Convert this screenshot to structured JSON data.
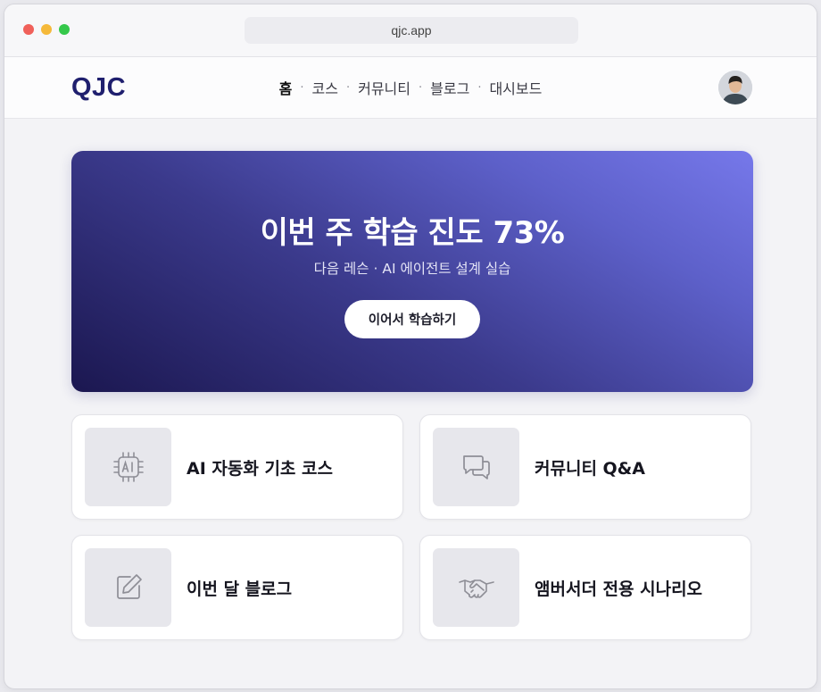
{
  "browser": {
    "url": "qjc.app"
  },
  "nav": {
    "logo": "QJC",
    "items": [
      {
        "label": "홈",
        "active": true
      },
      {
        "label": "코스",
        "active": false
      },
      {
        "label": "커뮤니티",
        "active": false
      },
      {
        "label": "블로그",
        "active": false
      },
      {
        "label": "대시보드",
        "active": false
      }
    ],
    "separator": "·"
  },
  "hero": {
    "title": "이번 주 학습 진도 73%",
    "progress_percent": 73,
    "subtitle": "다음 레슨 · AI 에이전트 설계 실습",
    "button_label": "이어서 학습하기"
  },
  "cards": [
    {
      "label": "AI 자동화 기초 코스",
      "icon": "ai-chip-icon"
    },
    {
      "label": "커뮤니티 Q&A",
      "icon": "chat-bubbles-icon"
    },
    {
      "label": "이번 달 블로그",
      "icon": "edit-pen-icon"
    },
    {
      "label": "앰버서더 전용 시나리오",
      "icon": "handshake-icon"
    }
  ],
  "colors": {
    "brand": "#1f1f6e",
    "hero_gradient_start": "#1b1750",
    "hero_gradient_end": "#7678ea",
    "icon_gray": "#8e8e96"
  }
}
